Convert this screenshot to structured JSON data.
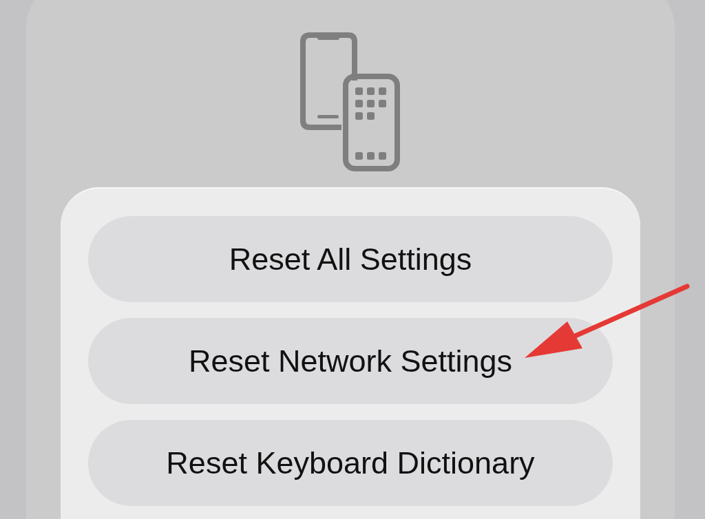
{
  "reset_options": [
    {
      "label": "Reset All Settings",
      "annotated": false
    },
    {
      "label": "Reset Network Settings",
      "annotated": true
    },
    {
      "label": "Reset Keyboard Dictionary",
      "annotated": false
    }
  ]
}
